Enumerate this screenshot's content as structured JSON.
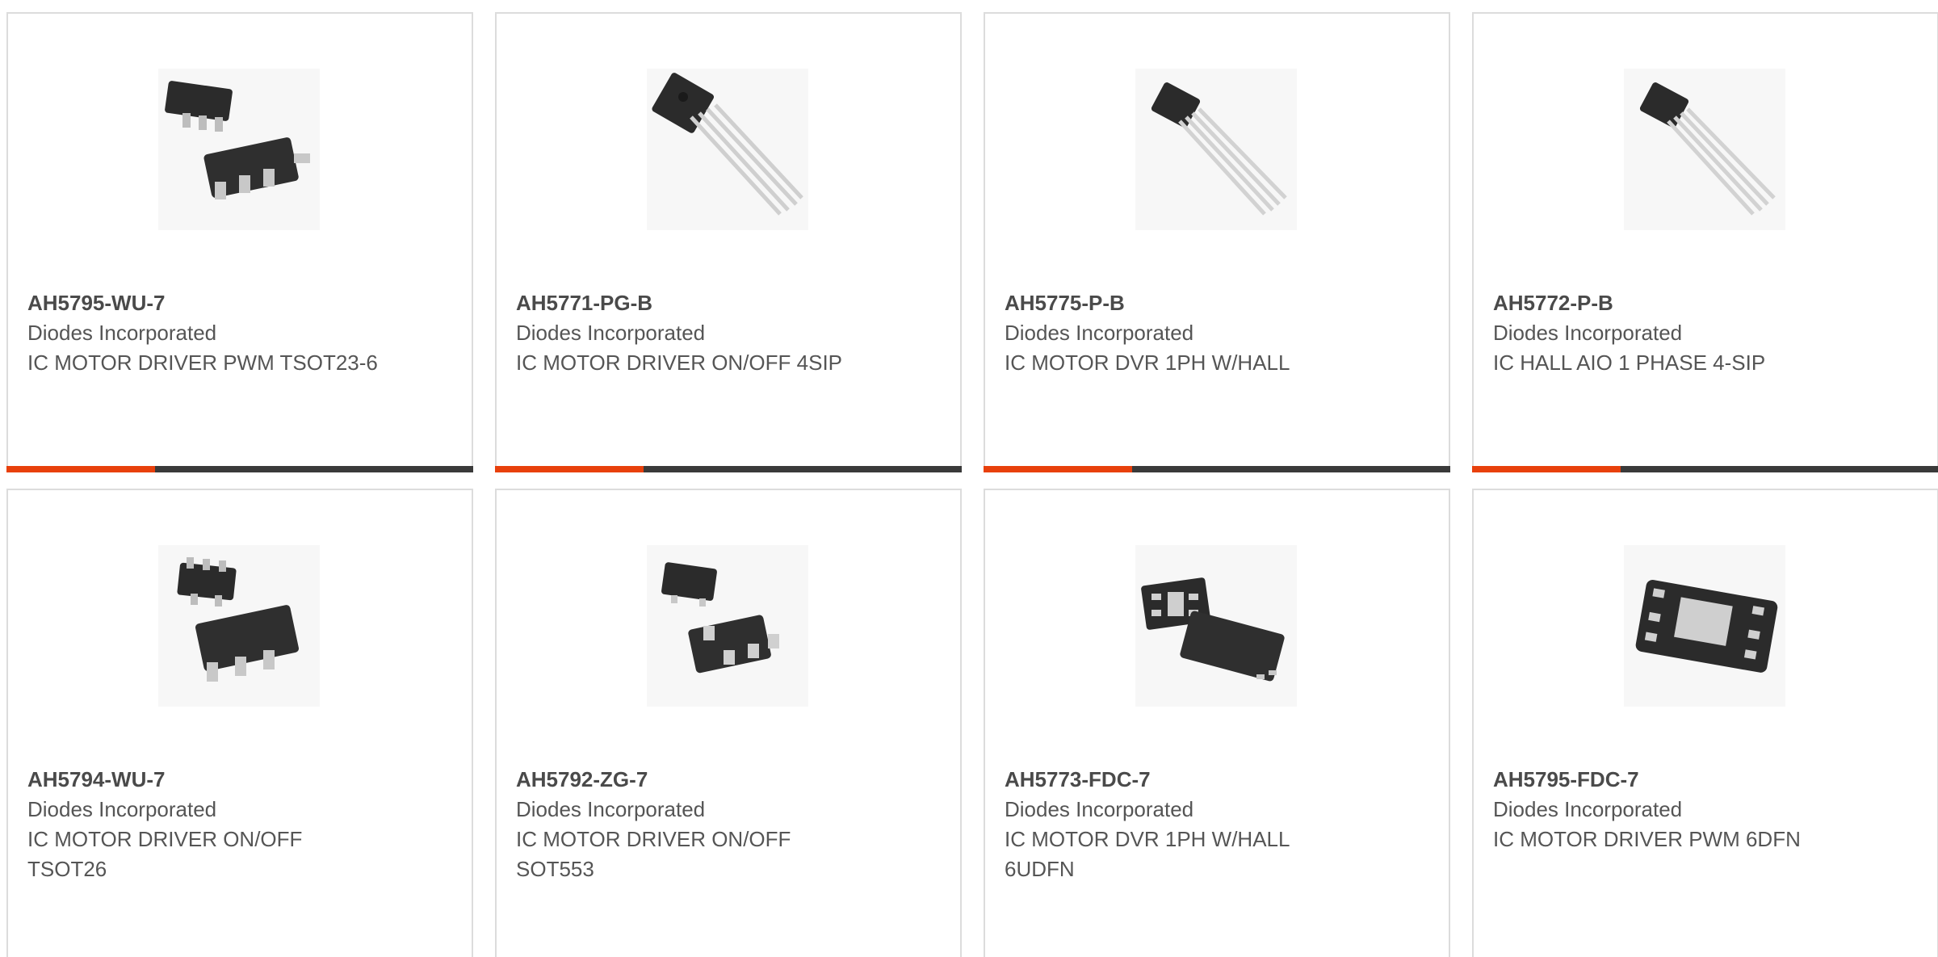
{
  "colors": {
    "accent": "#e8400c",
    "bar": "#3a3a3a",
    "border": "#dcdcdc"
  },
  "products": [
    {
      "part_number": "AH5795-WU-7",
      "manufacturer": "Diodes Incorporated",
      "description": "IC MOTOR DRIVER PWM TSOT23-6",
      "image": "tsot-6-chip-icon"
    },
    {
      "part_number": "AH5771-PG-B",
      "manufacturer": "Diodes Incorporated",
      "description": "IC MOTOR DRIVER ON/OFF 4SIP",
      "image": "sip-4-chip-icon"
    },
    {
      "part_number": "AH5775-P-B",
      "manufacturer": "Diodes Incorporated",
      "description": "IC MOTOR DVR 1PH W/HALL",
      "image": "sip-4-chip-icon"
    },
    {
      "part_number": "AH5772-P-B",
      "manufacturer": "Diodes Incorporated",
      "description": "IC HALL AIO 1 PHASE 4-SIP",
      "image": "sip-4-chip-icon"
    },
    {
      "part_number": "AH5794-WU-7",
      "manufacturer": "Diodes Incorporated",
      "description": "IC MOTOR DRIVER ON/OFF TSOT26",
      "image": "tsot-6-chip-icon"
    },
    {
      "part_number": "AH5792-ZG-7",
      "manufacturer": "Diodes Incorporated",
      "description": "IC MOTOR DRIVER ON/OFF SOT553",
      "image": "sot-553-chip-icon"
    },
    {
      "part_number": "AH5773-FDC-7",
      "manufacturer": "Diodes Incorporated",
      "description": "IC MOTOR DVR 1PH W/HALL 6UDFN",
      "image": "udfn-6-chip-icon"
    },
    {
      "part_number": "AH5795-FDC-7",
      "manufacturer": "Diodes Incorporated",
      "description": "IC MOTOR DRIVER PWM 6DFN",
      "image": "dfn-6-chip-icon"
    }
  ]
}
